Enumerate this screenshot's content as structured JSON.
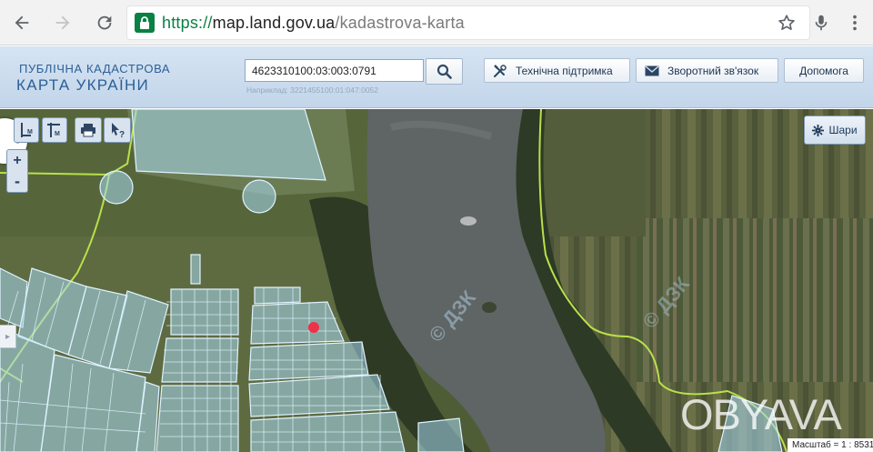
{
  "browser": {
    "url_scheme": "https://",
    "url_host": "map.land.gov.ua",
    "url_path": "/kadastrova-karta"
  },
  "site": {
    "logo_line1": "ПУБЛІЧНА КАДАСТРОВА",
    "logo_line2": "КАРТА УКРАЇНИ",
    "search": {
      "value": "4623310100:03:003:0791",
      "hint": "Наприклад: 3221455100:01:047:0052"
    },
    "buttons": {
      "support": "Технічна підтримка",
      "feedback": "Зворотний зв'язок",
      "help": "Допомога"
    }
  },
  "map": {
    "layers_label": "Шари",
    "scale_text": "Масштаб = 1 : 8531",
    "map_watermark": "© ДЗК",
    "image_watermark": "OBYAVA",
    "colors": {
      "parcel_fill": "#a8d8f0",
      "parcel_stroke": "#d8f0ff",
      "boundary_line": "#b9e04a",
      "marker": "#f0304a",
      "river": "#5f6464"
    }
  }
}
